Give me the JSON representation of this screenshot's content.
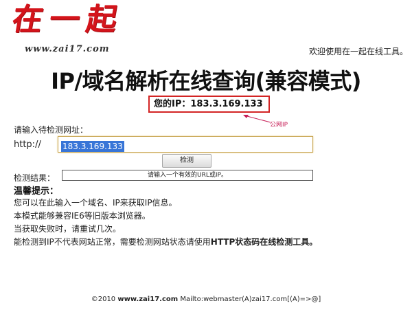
{
  "header": {
    "logo_text": "在一起",
    "site": "www.zai17.com",
    "welcome": "欢迎使用在一起在线工具。"
  },
  "main": {
    "title": "IP/域名解析在线查询(兼容模式)",
    "your_ip": "您的IP：183.3.169.133",
    "public_ip_note": "公网IP",
    "prompt": "请输入待检测网址：",
    "protocol": "http://",
    "input_value": "183.3.169.133",
    "check_button": "检测",
    "result_label": "检测结果：",
    "result_text": "请输入一个有效的URL或IP。"
  },
  "tips": {
    "title": "温馨提示：",
    "line1": "您可以在此输入一个域名、IP来获取IP信息。",
    "line2": "本模式能够兼容IE6等旧版本浏览器。",
    "line3": "当获取失败时，请重试几次。",
    "line4_prefix": "能检测到IP不代表网站正常，需要检测网站状态请使用",
    "line4_link": "HTTP状态码在线检测工具。"
  },
  "footer": {
    "copyright": "©2010 ",
    "domain": "www.zai17.com",
    "mailto": " Mailto:webmaster(A)zai17.com[(A)=>@]"
  },
  "colors": {
    "logo": "#d4141b",
    "ip_box_border": "#d32424",
    "annotation": "#c71f57",
    "selection": "#3875d7"
  }
}
